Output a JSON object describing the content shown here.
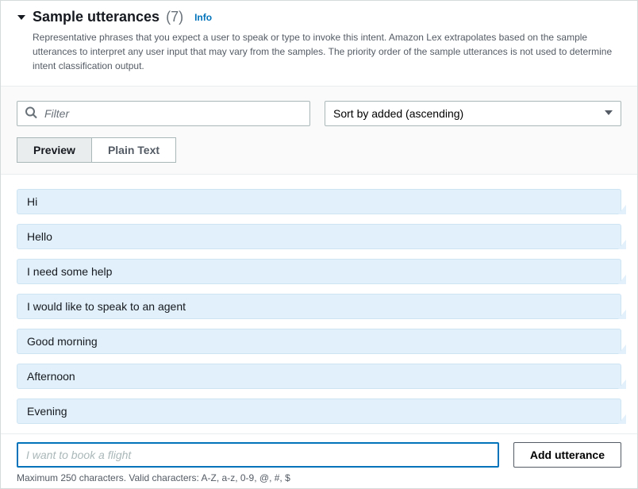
{
  "header": {
    "title": "Sample utterances",
    "count": "(7)",
    "info_label": "Info",
    "description": "Representative phrases that you expect a user to speak or type to invoke this intent. Amazon Lex extrapolates based on the sample utterances to interpret any user input that may vary from the samples. The priority order of the sample utterances is not used to determine intent classification output."
  },
  "controls": {
    "filter_placeholder": "Filter",
    "sort_label": "Sort by added (ascending)",
    "tabs": {
      "preview": "Preview",
      "plain_text": "Plain Text"
    }
  },
  "utterances": [
    "Hi",
    "Hello",
    "I need some help",
    "I would like to speak to an agent",
    "Good morning",
    "Afternoon",
    "Evening"
  ],
  "footer": {
    "input_placeholder": "I want to book a flight",
    "add_button": "Add utterance",
    "hint": "Maximum 250 characters. Valid characters: A-Z, a-z, 0-9, @, #, $"
  }
}
